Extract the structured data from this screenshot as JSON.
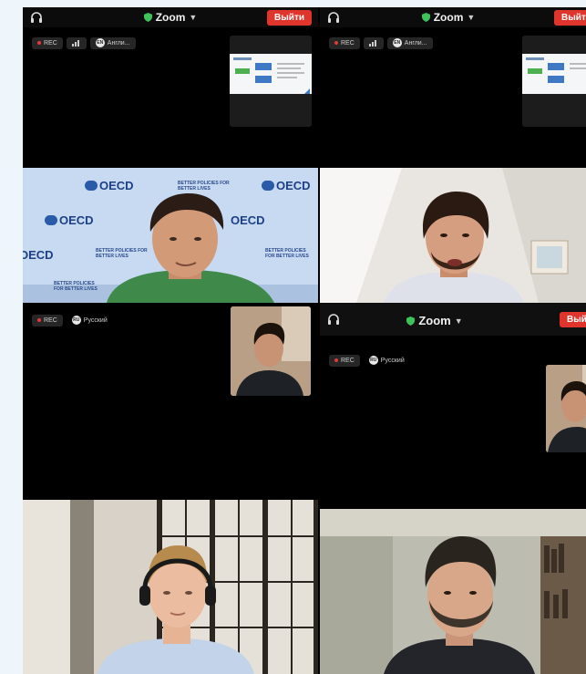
{
  "zoom_window": {
    "app_title": "Zoom",
    "leave_label": "Выйти",
    "rec_label": "REC",
    "language_english": "Англи...",
    "language_russian": "Русский",
    "language_badge": "EN",
    "language_badge_ru": "RU"
  },
  "backdrop": {
    "org_logo_text": "OECD",
    "slogan": "BETTER POLICIES FOR BETTER LIVES"
  },
  "colors": {
    "leave_button": "#e0352c",
    "zoom_bar": "#0c0c0c",
    "secure_shield": "#3ec35a",
    "oecd_blue": "#2a5ba8"
  }
}
